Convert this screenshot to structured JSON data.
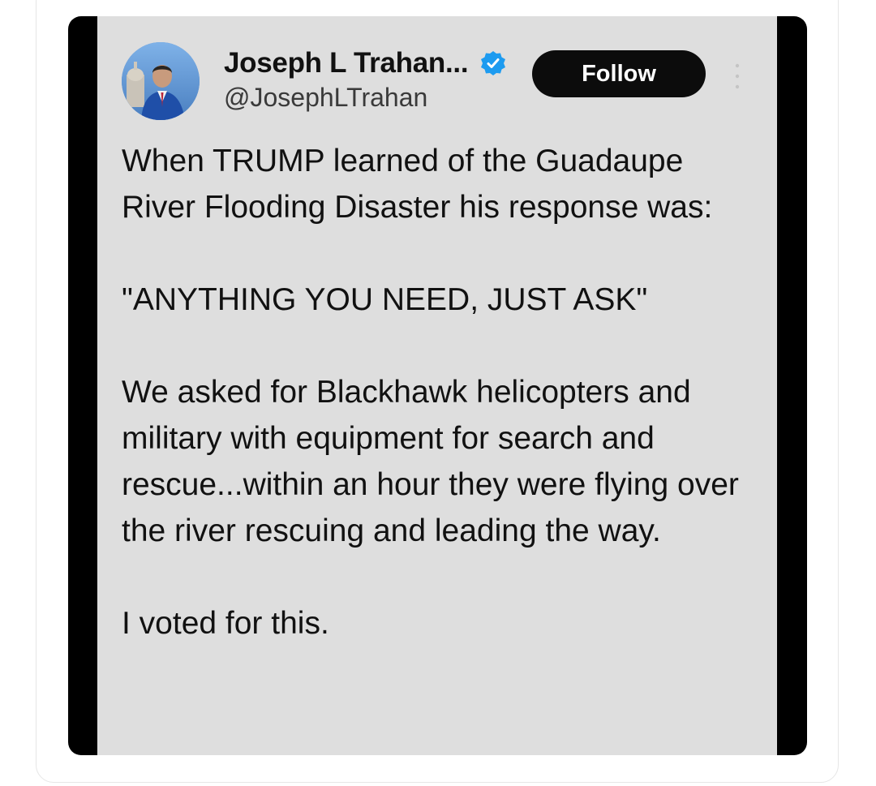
{
  "tweet": {
    "author_name": "Joseph L Trahan...",
    "author_handle": "@JosephLTrahan",
    "verified": true,
    "follow_label": "Follow",
    "paragraphs": [
      "When TRUMP learned of the Guadaupe River Flooding Disaster his response was:",
      "\"ANYTHING YOU NEED, JUST ASK\"",
      "We asked for Blackhawk helicopters and military with equipment for search and rescue...within an hour they were flying over the river rescuing and leading the way.",
      "I voted for this."
    ]
  },
  "icons": {
    "avatar": "avatar-photo",
    "verified": "verified-check-icon",
    "more": "more-options-icon"
  },
  "colors": {
    "panel_background": "#dedede",
    "frame_background": "#000000",
    "follow_button": "#0c0c0c",
    "verified_blue": "#1d9bf0"
  }
}
